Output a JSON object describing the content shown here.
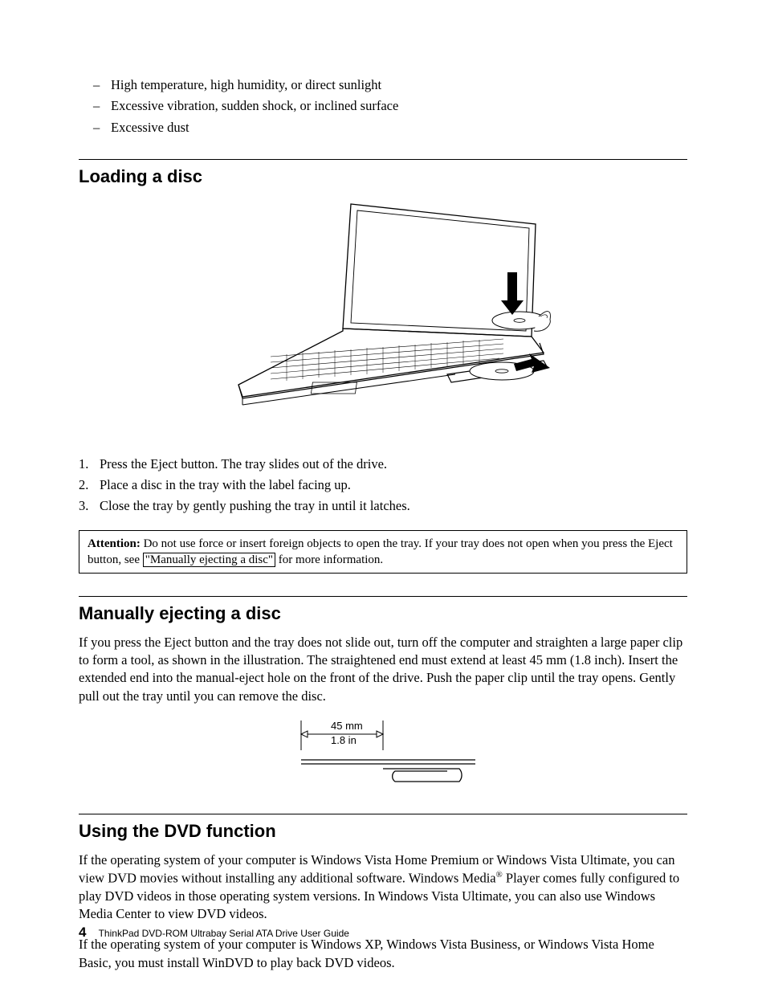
{
  "dashList": {
    "i0": "High temperature, high humidity, or direct sunlight",
    "i1": "Excessive vibration, sudden shock, or inclined surface",
    "i2": "Excessive dust"
  },
  "sections": {
    "loading": "Loading a disc",
    "manual": "Manually ejecting a disc",
    "dvd": "Using the DVD function"
  },
  "loadingSteps": {
    "s1n": "1.",
    "s1": "Press the Eject button. The tray slides out of the drive.",
    "s2n": "2.",
    "s2": "Place a disc in the tray with the label facing up.",
    "s3n": "3.",
    "s3": "Close the tray by gently pushing the tray in until it latches."
  },
  "attention": {
    "label": "Attention:",
    "t1": " Do not use force or insert foreign objects to open the tray. If your tray does not open when you press the Eject button, see ",
    "link": "\"Manually ejecting a disc\"",
    "t2": " for more information."
  },
  "manualPara": "If you press the Eject button and the tray does not slide out, turn off the computer and straighten a large paper clip to form a tool, as shown in the illustration. The straightened end must extend at least 45 mm (1.8 inch). Insert the extended end into the manual-eject hole on the front of the drive. Push the paper clip until the tray opens. Gently pull out the tray until you can remove the disc.",
  "clipLabels": {
    "mm": "45 mm",
    "in": "1.8 in"
  },
  "dvdPara1a": "If the operating system of your computer is Windows Vista Home Premium or Windows Vista Ultimate, you can view DVD movies without installing any additional software. Windows Media",
  "dvdPara1b": " Player comes fully configured to play DVD videos in those operating system versions. In Windows Vista Ultimate, you can also use Windows Media Center to view DVD videos.",
  "dvdPara2": "If the operating system of your computer is Windows XP, Windows Vista Business, or Windows Vista Home Basic, you must install WinDVD to play back DVD videos.",
  "footer": {
    "page": "4",
    "title": "ThinkPad DVD-ROM Ultrabay Serial ATA Drive User Guide"
  }
}
